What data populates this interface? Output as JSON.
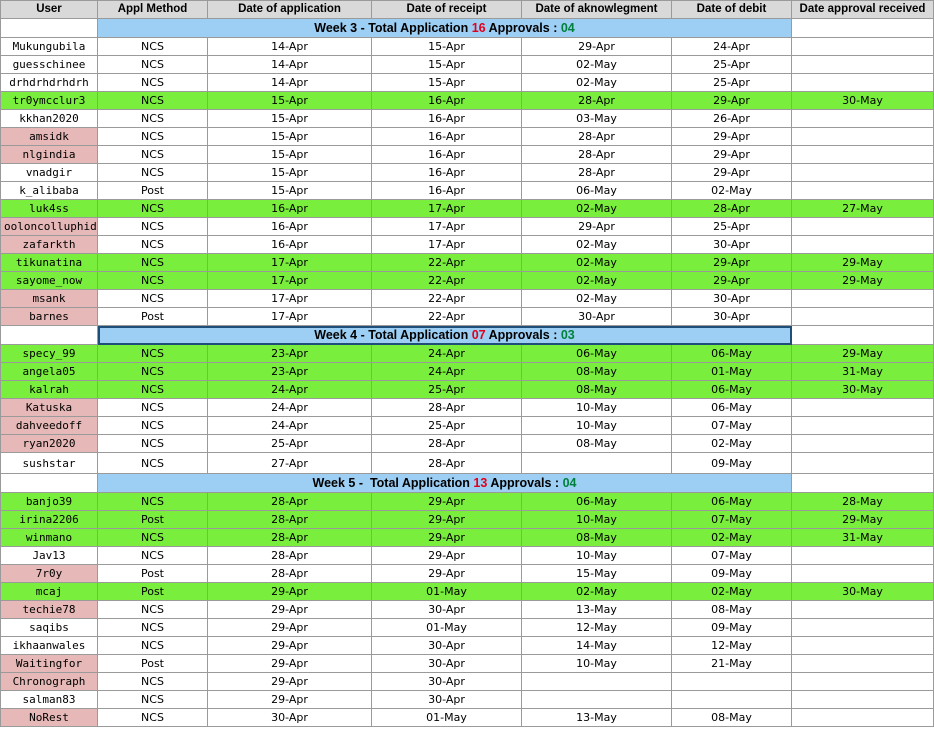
{
  "columns": [
    "User",
    "Appl Method",
    "Date of application",
    "Date of receipt",
    "Date of aknowlegment",
    "Date of debit",
    "Date approval received"
  ],
  "sections": [
    {
      "header": {
        "prefix": "Week 3 - Total Application ",
        "total": "16",
        "mid": " Approvals : ",
        "approvals": "04"
      },
      "rows": [
        {
          "user": "Mukungubila",
          "method": "NCS",
          "application": "14-Apr",
          "receipt": "15-Apr",
          "ack": "29-Apr",
          "debit": "24-Apr",
          "approval": "",
          "status": "none"
        },
        {
          "user": "guesschinee",
          "method": "NCS",
          "application": "14-Apr",
          "receipt": "15-Apr",
          "ack": "02-May",
          "debit": "25-Apr",
          "approval": "",
          "status": "none"
        },
        {
          "user": "drhdrhdrhdrh",
          "method": "NCS",
          "application": "14-Apr",
          "receipt": "15-Apr",
          "ack": "02-May",
          "debit": "25-Apr",
          "approval": "",
          "status": "none"
        },
        {
          "user": "tr0ymcclur3",
          "method": "NCS",
          "application": "15-Apr",
          "receipt": "16-Apr",
          "ack": "28-Apr",
          "debit": "29-Apr",
          "approval": "30-May",
          "status": "approved"
        },
        {
          "user": "kkhan2020",
          "method": "NCS",
          "application": "15-Apr",
          "receipt": "16-Apr",
          "ack": "03-May",
          "debit": "26-Apr",
          "approval": "",
          "status": "none"
        },
        {
          "user": "amsidk",
          "method": "NCS",
          "application": "15-Apr",
          "receipt": "16-Apr",
          "ack": "28-Apr",
          "debit": "29-Apr",
          "approval": "",
          "status": "pink"
        },
        {
          "user": "nlgindia",
          "method": "NCS",
          "application": "15-Apr",
          "receipt": "16-Apr",
          "ack": "28-Apr",
          "debit": "29-Apr",
          "approval": "",
          "status": "pink"
        },
        {
          "user": "vnadgir",
          "method": "NCS",
          "application": "15-Apr",
          "receipt": "16-Apr",
          "ack": "28-Apr",
          "debit": "29-Apr",
          "approval": "",
          "status": "none"
        },
        {
          "user": "k_alibaba",
          "method": "Post",
          "application": "15-Apr",
          "receipt": "16-Apr",
          "ack": "06-May",
          "debit": "02-May",
          "approval": "",
          "status": "none"
        },
        {
          "user": "luk4ss",
          "method": "NCS",
          "application": "16-Apr",
          "receipt": "17-Apr",
          "ack": "02-May",
          "debit": "28-Apr",
          "approval": "27-May",
          "status": "approved"
        },
        {
          "user": "ooloncolluphid",
          "method": "NCS",
          "application": "16-Apr",
          "receipt": "17-Apr",
          "ack": "29-Apr",
          "debit": "25-Apr",
          "approval": "",
          "status": "pink"
        },
        {
          "user": "zafarkth",
          "method": "NCS",
          "application": "16-Apr",
          "receipt": "17-Apr",
          "ack": "02-May",
          "debit": "30-Apr",
          "approval": "",
          "status": "pink"
        },
        {
          "user": "tikunatina",
          "method": "NCS",
          "application": "17-Apr",
          "receipt": "22-Apr",
          "ack": "02-May",
          "debit": "29-Apr",
          "approval": "29-May",
          "status": "approved"
        },
        {
          "user": "sayome_now",
          "method": "NCS",
          "application": "17-Apr",
          "receipt": "22-Apr",
          "ack": "02-May",
          "debit": "29-Apr",
          "approval": "29-May",
          "status": "approved"
        },
        {
          "user": "msank",
          "method": "NCS",
          "application": "17-Apr",
          "receipt": "22-Apr",
          "ack": "02-May",
          "debit": "30-Apr",
          "approval": "",
          "status": "pink"
        },
        {
          "user": "barnes",
          "method": "Post",
          "application": "17-Apr",
          "receipt": "22-Apr",
          "ack": "30-Apr",
          "debit": "30-Apr",
          "approval": "",
          "status": "pink"
        }
      ]
    },
    {
      "header": {
        "prefix": "Week 4 - Total Application ",
        "total": "07",
        "mid": " Approvals : ",
        "approvals": "03"
      },
      "rows": [
        {
          "user": "specy_99",
          "method": "NCS",
          "application": "23-Apr",
          "receipt": "24-Apr",
          "ack": "06-May",
          "debit": "06-May",
          "approval": "29-May",
          "status": "approved"
        },
        {
          "user": "angela05",
          "method": "NCS",
          "application": "23-Apr",
          "receipt": "24-Apr",
          "ack": "08-May",
          "debit": "01-May",
          "approval": "31-May",
          "status": "approved"
        },
        {
          "user": "kalrah",
          "method": "NCS",
          "application": "24-Apr",
          "receipt": "25-Apr",
          "ack": "08-May",
          "debit": "06-May",
          "approval": "30-May",
          "status": "approved"
        },
        {
          "user": "Katuska",
          "method": "NCS",
          "application": "24-Apr",
          "receipt": "28-Apr",
          "ack": "10-May",
          "debit": "06-May",
          "approval": "",
          "status": "pink"
        },
        {
          "user": "dahveedoff",
          "method": "NCS",
          "application": "24-Apr",
          "receipt": "25-Apr",
          "ack": "10-May",
          "debit": "07-May",
          "approval": "",
          "status": "pink"
        },
        {
          "user": "ryan2020",
          "method": "NCS",
          "application": "25-Apr",
          "receipt": "28-Apr",
          "ack": "08-May",
          "debit": "02-May",
          "approval": "",
          "status": "pink"
        },
        {
          "user": "sushstar",
          "method": "NCS",
          "application": "27-Apr",
          "receipt": "28-Apr",
          "ack": "",
          "debit": "09-May",
          "approval": "",
          "status": "none"
        }
      ]
    },
    {
      "header": {
        "prefix": "Week 5 -  Total Application ",
        "total": "13",
        "mid": " Approvals : ",
        "approvals": "04"
      },
      "rows": [
        {
          "user": "banjo39",
          "method": "NCS",
          "application": "28-Apr",
          "receipt": "29-Apr",
          "ack": "06-May",
          "debit": "06-May",
          "approval": "28-May",
          "status": "approved"
        },
        {
          "user": "irina2206",
          "method": "Post",
          "application": "28-Apr",
          "receipt": "29-Apr",
          "ack": "10-May",
          "debit": "07-May",
          "approval": "29-May",
          "status": "approved"
        },
        {
          "user": "winmano",
          "method": "NCS",
          "application": "28-Apr",
          "receipt": "29-Apr",
          "ack": "08-May",
          "debit": "02-May",
          "approval": "31-May",
          "status": "approved"
        },
        {
          "user": "Jav13",
          "method": "NCS",
          "application": "28-Apr",
          "receipt": "29-Apr",
          "ack": "10-May",
          "debit": "07-May",
          "approval": "",
          "status": "none"
        },
        {
          "user": "7r0y",
          "method": "Post",
          "application": "28-Apr",
          "receipt": "29-Apr",
          "ack": "15-May",
          "debit": "09-May",
          "approval": "",
          "status": "pink"
        },
        {
          "user": "mcaj",
          "method": "Post",
          "application": "29-Apr",
          "receipt": "01-May",
          "ack": "02-May",
          "debit": "02-May",
          "approval": "30-May",
          "status": "approved"
        },
        {
          "user": "techie78",
          "method": "NCS",
          "application": "29-Apr",
          "receipt": "30-Apr",
          "ack": "13-May",
          "debit": "08-May",
          "approval": "",
          "status": "pink"
        },
        {
          "user": "saqibs",
          "method": "NCS",
          "application": "29-Apr",
          "receipt": "01-May",
          "ack": "12-May",
          "debit": "09-May",
          "approval": "",
          "status": "none"
        },
        {
          "user": "ikhaanwales",
          "method": "NCS",
          "application": "29-Apr",
          "receipt": "30-Apr",
          "ack": "14-May",
          "debit": "12-May",
          "approval": "",
          "status": "none"
        },
        {
          "user": "Waitingfor",
          "method": "Post",
          "application": "29-Apr",
          "receipt": "30-Apr",
          "ack": "10-May",
          "debit": "21-May",
          "approval": "",
          "status": "pink"
        },
        {
          "user": "Chronograph",
          "method": "NCS",
          "application": "29-Apr",
          "receipt": "30-Apr",
          "ack": "",
          "debit": "",
          "approval": "",
          "status": "pink"
        },
        {
          "user": "salman83",
          "method": "NCS",
          "application": "29-Apr",
          "receipt": "30-Apr",
          "ack": "",
          "debit": "",
          "approval": "",
          "status": "none"
        },
        {
          "user": "NoRest",
          "method": "NCS",
          "application": "30-Apr",
          "receipt": "01-May",
          "ack": "13-May",
          "debit": "08-May",
          "approval": "",
          "status": "pink"
        }
      ]
    }
  ],
  "colors": {
    "approved": "#7aee3c",
    "pink": "#e6b8b7",
    "week_header": "#9dcff5",
    "total_red": "#e0001b",
    "approvals_green": "#00803a"
  }
}
